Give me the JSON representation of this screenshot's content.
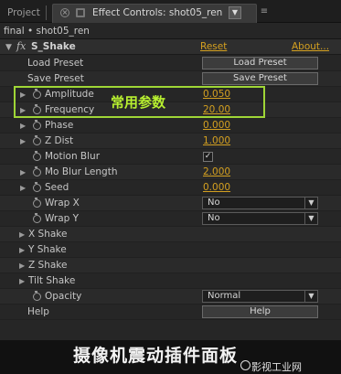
{
  "tabs": {
    "project_label": "Project",
    "active_label": "Effect Controls: shot05_ren",
    "close_glyph": "×",
    "dropdown_glyph": "▼",
    "menu_glyph": "≡"
  },
  "breadcrumb": "final • shot05_ren",
  "effect": {
    "name": "S_Shake",
    "reset_label": "Reset",
    "about_label": "About..."
  },
  "rows": {
    "load_preset": {
      "label": "Load Preset",
      "button": "Load Preset"
    },
    "save_preset": {
      "label": "Save Preset",
      "button": "Save Preset"
    },
    "amplitude": {
      "label": "Amplitude",
      "value": "0.050"
    },
    "frequency": {
      "label": "Frequency",
      "value": "20.00"
    },
    "phase": {
      "label": "Phase",
      "value": "0.000"
    },
    "z_dist": {
      "label": "Z Dist",
      "value": "1.000"
    },
    "motion_blur": {
      "label": "Motion Blur",
      "checked": "✓"
    },
    "mo_blur_length": {
      "label": "Mo Blur Length",
      "value": "2.000"
    },
    "seed": {
      "label": "Seed",
      "value": "0.000"
    },
    "wrap_x": {
      "label": "Wrap X",
      "selected": "No"
    },
    "wrap_y": {
      "label": "Wrap Y",
      "selected": "No"
    },
    "x_shake": {
      "label": "X Shake"
    },
    "y_shake": {
      "label": "Y Shake"
    },
    "z_shake": {
      "label": "Z Shake"
    },
    "tilt_shake": {
      "label": "Tilt Shake"
    },
    "opacity": {
      "label": "Opacity",
      "selected": "Normal"
    },
    "help": {
      "label": "Help",
      "button": "Help"
    }
  },
  "annotation": "常用参数",
  "caption": "摄像机震动插件面板",
  "watermark": "影视工业网",
  "colors": {
    "panel_bg": "#262626",
    "value_orange": "#d4a020",
    "annotation_green": "#9fd636"
  },
  "icons": {
    "expand": "▶",
    "collapse": "▼",
    "select_arrow": "▼"
  }
}
